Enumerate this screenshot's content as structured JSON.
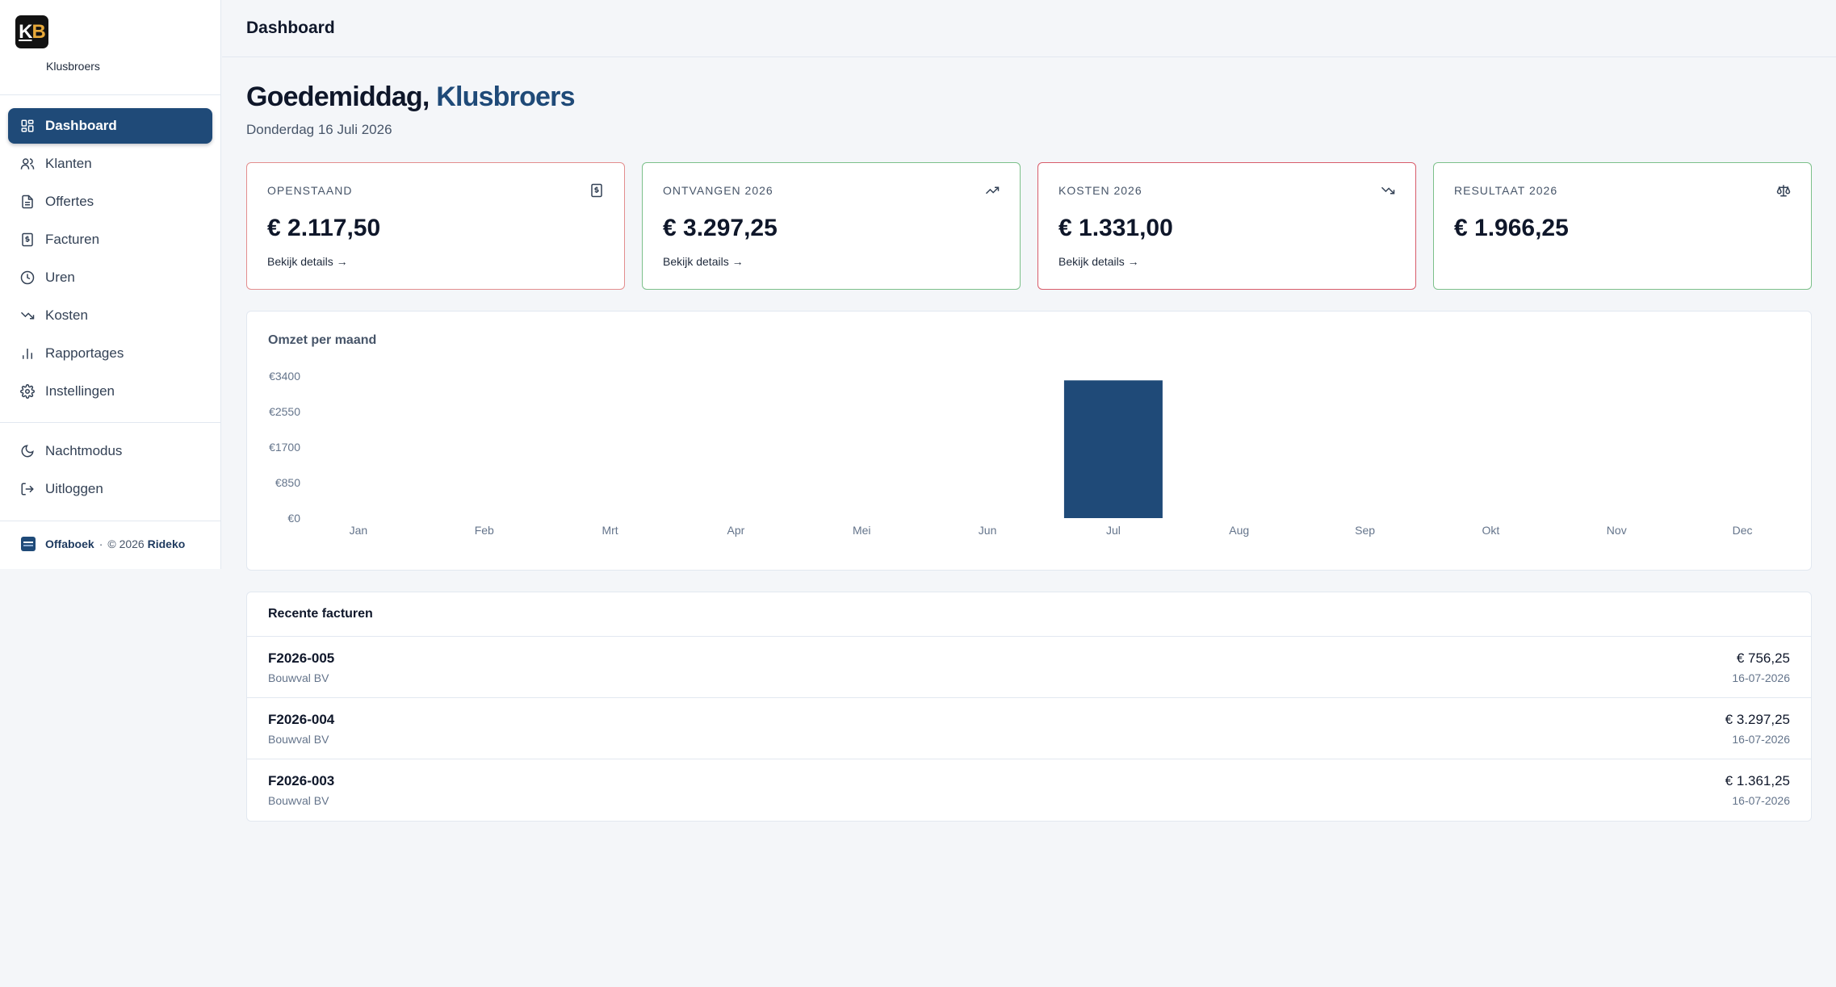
{
  "sidebar": {
    "logo_k": "K",
    "logo_b": "B",
    "company": "Klusbroers",
    "items": [
      {
        "label": "Dashboard",
        "icon": "grid-icon",
        "active": true
      },
      {
        "label": "Klanten",
        "icon": "users-icon"
      },
      {
        "label": "Offertes",
        "icon": "document-icon"
      },
      {
        "label": "Facturen",
        "icon": "invoice-icon"
      },
      {
        "label": "Uren",
        "icon": "clock-icon"
      },
      {
        "label": "Kosten",
        "icon": "trending-down-icon"
      },
      {
        "label": "Rapportages",
        "icon": "bar-chart-icon"
      },
      {
        "label": "Instellingen",
        "icon": "gear-icon"
      }
    ],
    "bottom_items": [
      {
        "label": "Nachtmodus",
        "icon": "moon-icon"
      },
      {
        "label": "Uitloggen",
        "icon": "logout-icon"
      }
    ],
    "footer": {
      "app": "Offaboek",
      "sep": "·",
      "copyright": "© 2026",
      "vendor": "Rideko"
    }
  },
  "topbar": {
    "title": "Dashboard"
  },
  "greeting": {
    "prefix": "Goedemiddag,",
    "name": "Klusbroers"
  },
  "date": "Donderdag 16 Juli 2026",
  "cards": [
    {
      "label": "OPENSTAAND",
      "value": "€ 2.117,50",
      "link": "Bekijk details →",
      "icon": "invoice-icon",
      "accent": "#e38e8e"
    },
    {
      "label": "ONTVANGEN 2026",
      "value": "€ 3.297,25",
      "link": "Bekijk details →",
      "icon": "trending-up-icon",
      "accent": "#7cc08a"
    },
    {
      "label": "KOSTEN 2026",
      "value": "€ 1.331,00",
      "link": "Bekijk details →",
      "icon": "trending-down-icon",
      "accent": "#d85c6a"
    },
    {
      "label": "RESULTAAT 2026",
      "value": "€ 1.966,25",
      "icon": "scale-icon",
      "accent": "#7cc08a"
    }
  ],
  "chart_data": {
    "type": "bar",
    "title": "Omzet per maand",
    "categories": [
      "Jan",
      "Feb",
      "Mrt",
      "Apr",
      "Mei",
      "Jun",
      "Jul",
      "Aug",
      "Sep",
      "Okt",
      "Nov",
      "Dec"
    ],
    "values": [
      0,
      0,
      0,
      0,
      0,
      0,
      3297.25,
      0,
      0,
      0,
      0,
      0
    ],
    "yticks": [
      "€0",
      "€850",
      "€1700",
      "€2550",
      "€3400"
    ],
    "ylim": [
      0,
      3400
    ],
    "color": "#1f4a78",
    "grid": false
  },
  "recent": {
    "title": "Recente facturen",
    "rows": [
      {
        "number": "F2026-005",
        "client": "Bouwval BV",
        "amount": "€ 756,25",
        "date": "16-07-2026"
      },
      {
        "number": "F2026-004",
        "client": "Bouwval BV",
        "amount": "€ 3.297,25",
        "date": "16-07-2026"
      },
      {
        "number": "F2026-003",
        "client": "Bouwval BV",
        "amount": "€ 1.361,25",
        "date": "16-07-2026"
      }
    ]
  }
}
